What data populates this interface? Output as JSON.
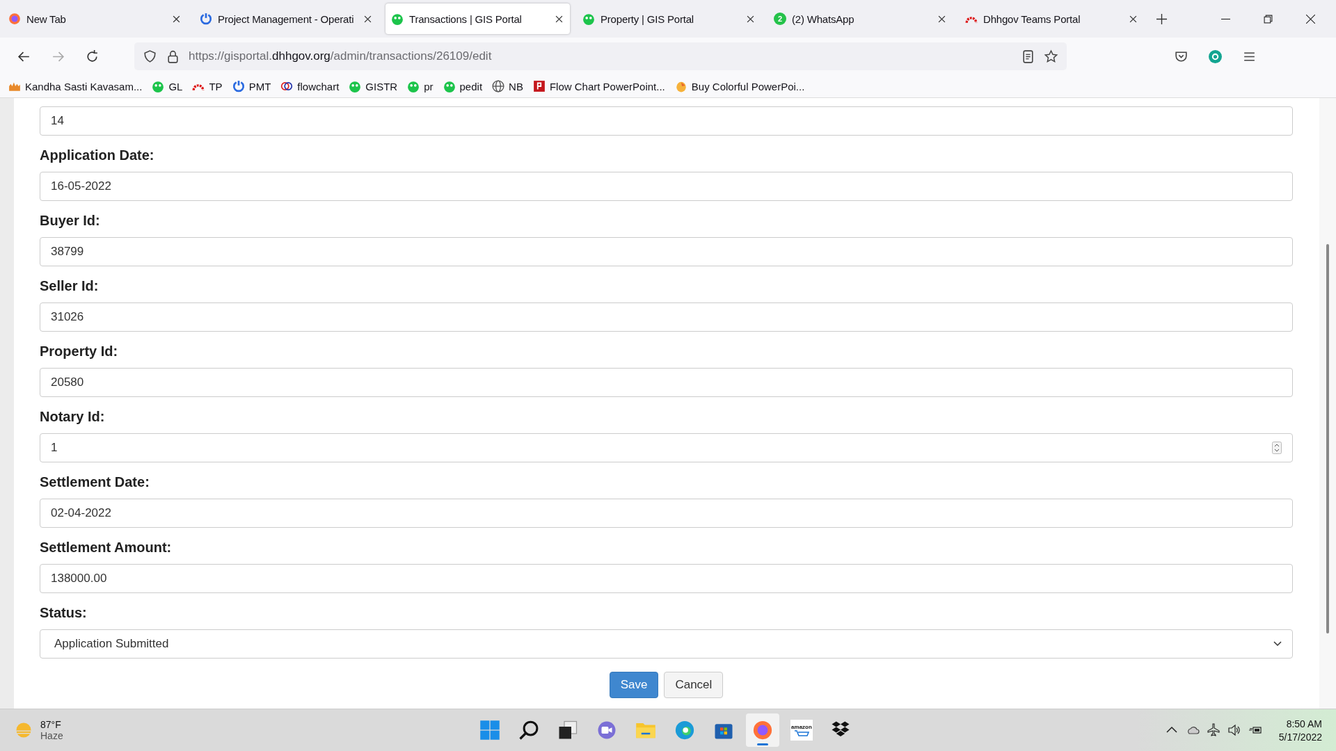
{
  "tabs": [
    {
      "title": "New Tab",
      "kind": "firefox",
      "selected": false
    },
    {
      "title": "Project Management - Operati",
      "kind": "power",
      "selected": false
    },
    {
      "title": "Transactions | GIS Portal",
      "kind": "gis",
      "selected": true
    },
    {
      "title": "Property | GIS Portal",
      "kind": "gis",
      "selected": false
    },
    {
      "title": "(2) WhatsApp",
      "kind": "whatsapp",
      "badge": "2",
      "selected": false
    },
    {
      "title": "Dhhgov Teams Portal",
      "kind": "arc",
      "selected": false
    }
  ],
  "address": {
    "prefix": "https://gisportal.",
    "domain": "dhhgov.org",
    "path": "/admin/transactions/26109/edit"
  },
  "bookmarks": [
    {
      "label": "Kandha Sasti Kavasam...",
      "kind": "temple"
    },
    {
      "label": "GL",
      "kind": "gis"
    },
    {
      "label": "TP",
      "kind": "arc"
    },
    {
      "label": "PMT",
      "kind": "power"
    },
    {
      "label": "flowchart",
      "kind": "oc"
    },
    {
      "label": "GISTR",
      "kind": "gis"
    },
    {
      "label": "pr",
      "kind": "gis"
    },
    {
      "label": "pedit",
      "kind": "gis"
    },
    {
      "label": "NB",
      "kind": "globe"
    },
    {
      "label": "Flow Chart PowerPoint...",
      "kind": "p"
    },
    {
      "label": "Buy Colorful PowerPoi...",
      "kind": "egg"
    }
  ],
  "form": {
    "fields": [
      {
        "value": "14",
        "kind": "text"
      },
      {
        "label": "Application Date:",
        "value": "16-05-2022",
        "kind": "text"
      },
      {
        "label": "Buyer Id:",
        "value": "38799",
        "kind": "text"
      },
      {
        "label": "Seller Id:",
        "value": "31026",
        "kind": "text"
      },
      {
        "label": "Property Id:",
        "value": "20580",
        "kind": "text"
      },
      {
        "label": "Notary Id:",
        "value": "1",
        "kind": "number"
      },
      {
        "label": "Settlement Date:",
        "value": "02-04-2022",
        "kind": "text"
      },
      {
        "label": "Settlement Amount:",
        "value": "138000.00",
        "kind": "text"
      },
      {
        "label": "Status:",
        "value": "Application Submitted",
        "kind": "select"
      }
    ],
    "buttons": [
      {
        "label": "Save",
        "kind": "primary"
      },
      {
        "label": "Cancel",
        "kind": "default"
      }
    ]
  },
  "taskbar": {
    "weather": {
      "temp": "87°F",
      "condition": "Haze"
    },
    "apps": [
      {
        "kind": "start",
        "active": false
      },
      {
        "kind": "search",
        "active": false
      },
      {
        "kind": "taskview",
        "active": false
      },
      {
        "kind": "chat",
        "active": false
      },
      {
        "kind": "folder",
        "active": false
      },
      {
        "kind": "edge",
        "active": false
      },
      {
        "kind": "store",
        "active": false
      },
      {
        "kind": "firefox",
        "active": true
      },
      {
        "kind": "amazon",
        "label": "amazon",
        "active": false
      },
      {
        "kind": "dropbox",
        "active": false
      }
    ],
    "time": "8:50 AM",
    "date": "5/17/2022"
  }
}
